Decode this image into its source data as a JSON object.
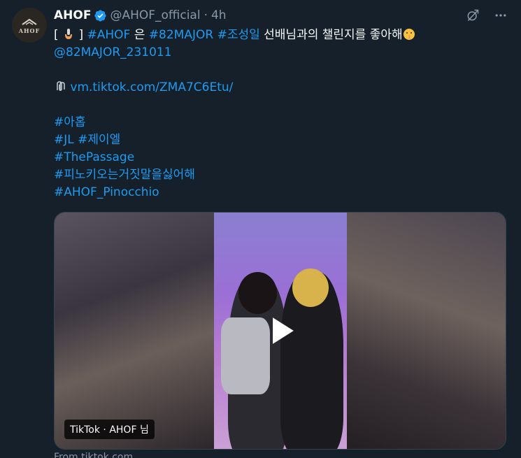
{
  "account": {
    "display_name": "AHOF",
    "handle": "@AHOF_official",
    "separator": "·",
    "time": "4h",
    "avatar_text": "AHOF"
  },
  "tweet": {
    "line1": {
      "open_bracket": "[",
      "close_bracket": "]",
      "hashtag_ahof": "#AHOF",
      "particle": "은",
      "hashtag_82major": "#82MAJOR",
      "hashtag_name": "#조성일",
      "text": "선배님과의 챌린지를 좋아해"
    },
    "line2_mention": "@82MAJOR_231011",
    "link_text": "vm.tiktok.com/ZMA7C6Etu/",
    "hashtags": [
      "#아홉",
      "#JL #제이엘",
      "#ThePassage",
      "#피노키오는거짓말을싫어해",
      "#AHOF_Pinocchio"
    ]
  },
  "media": {
    "source_label": "TikTok · AHOF 님"
  },
  "footer": {
    "from_text": "From tiktok.com"
  },
  "colors": {
    "background": "#15202b",
    "link": "#1d9bf0",
    "muted": "#8b98a5",
    "verified": "#1d9bf0"
  },
  "icons": {
    "verified": "verified-badge-icon",
    "grok": "grok-icon",
    "more": "more-options-icon",
    "link": "paperclip-icon",
    "play": "play-icon"
  }
}
